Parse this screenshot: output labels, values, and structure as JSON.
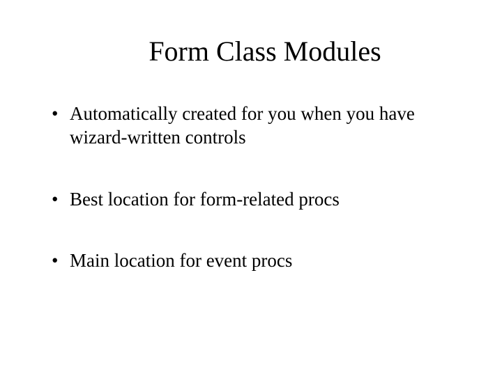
{
  "title": "Form Class Modules",
  "bullets": [
    "Automatically created for you when you have wizard-written controls",
    "Best location for form-related procs",
    "Main location for event procs"
  ]
}
